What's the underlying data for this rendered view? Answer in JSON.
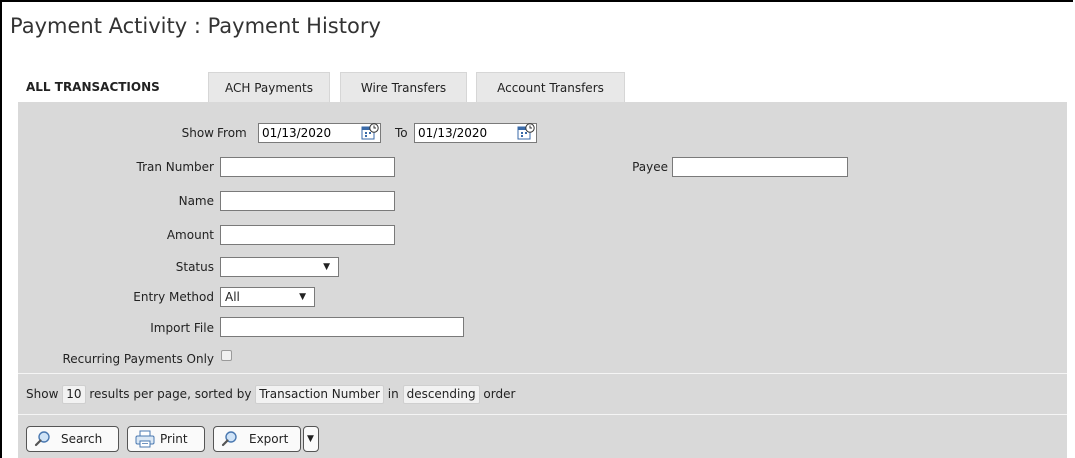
{
  "page": {
    "title": "Payment Activity : Payment History"
  },
  "tabs": [
    {
      "label": "ALL TRANSACTIONS"
    },
    {
      "label": "ACH Payments"
    },
    {
      "label": "Wire Transfers"
    },
    {
      "label": "Account Transfers"
    }
  ],
  "form": {
    "show_label": "Show",
    "from_label": "From",
    "from_value": "01/13/2020",
    "to_label": "To",
    "to_value": "01/13/2020",
    "tran_number_label": "Tran Number",
    "tran_number_value": "",
    "payee_label": "Payee",
    "payee_value": "",
    "name_label": "Name",
    "name_value": "",
    "amount_label": "Amount",
    "amount_value": "",
    "status_label": "Status",
    "status_value": "",
    "entry_method_label": "Entry Method",
    "entry_method_value": "All",
    "import_file_label": "Import File",
    "import_file_value": "",
    "recurring_label": "Recurring Payments Only"
  },
  "sort": {
    "show": "Show",
    "per_page": "10",
    "results_text": "results per page, sorted by",
    "sort_field": "Transaction Number",
    "in_text": "in",
    "order": "descending",
    "order_text": "order"
  },
  "buttons": {
    "search": "Search",
    "print": "Print",
    "export": "Export"
  },
  "icons": [
    "calendar-icon",
    "magnifier-icon",
    "printer-icon",
    "dropdown-arrow-icon"
  ]
}
